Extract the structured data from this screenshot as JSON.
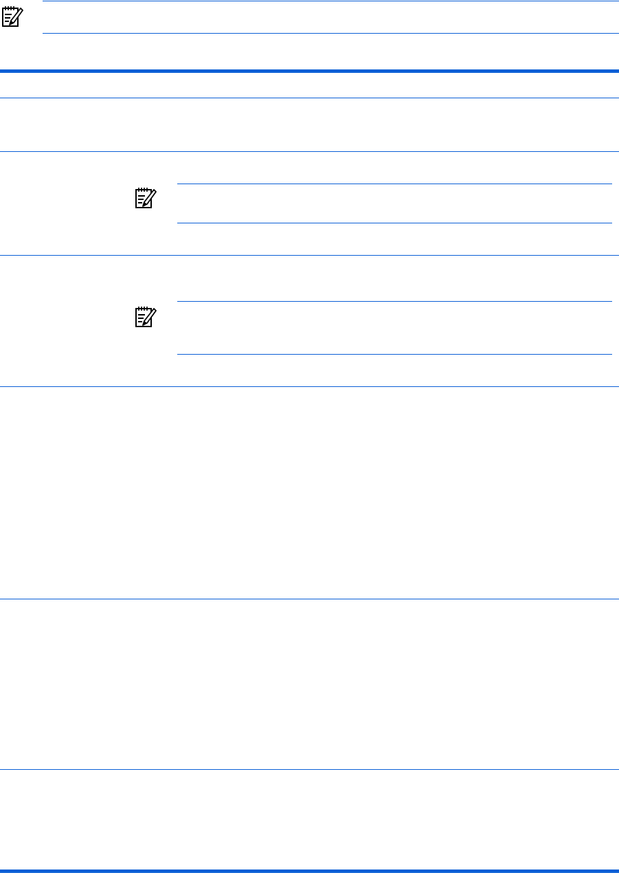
{
  "colors": {
    "rule": "#0a5fd6",
    "ink": "#000000",
    "background": "#ffffff"
  },
  "icons": {
    "top_note": "note-pencil-icon",
    "row_note_a": "note-pencil-icon",
    "row_note_b": "note-pencil-icon"
  },
  "top_note": {
    "text": ""
  },
  "table": {
    "header": {
      "col1": "",
      "col2": ""
    },
    "rows": [
      {
        "label": "",
        "text": ""
      },
      {
        "label": "",
        "text": "",
        "note": ""
      },
      {
        "label": "",
        "text": "",
        "note": ""
      },
      {
        "label": "",
        "text": ""
      },
      {
        "label": "",
        "text": ""
      },
      {
        "label": "",
        "text": ""
      }
    ]
  }
}
